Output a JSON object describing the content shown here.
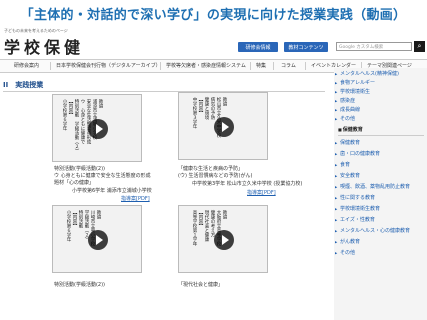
{
  "banner": {
    "title": "「主体的・対話的で深い学び」の実現に向けた授業実践（動画）"
  },
  "header": {
    "logo_sub": "子どもの未来を考えるためのページ",
    "logo": "学校保健",
    "btn1": "研修会情報",
    "btn2": "教材コンテンツ",
    "search_placeholder": "Google カスタム検索"
  },
  "nav": [
    "研修会案内",
    "日本学校保健会刊行物（デジタルアーカイブ）",
    "学校等欠席者・感染症情報システム",
    "特集",
    "コラム",
    "イベントカレンダー",
    "テーマ別関連ページ"
  ],
  "section": {
    "title": "II　実践授業"
  },
  "videos": [
    {
      "lines": [
        "小学校第６学年",
        "【内容】",
        "特別活動　学級活動（２）",
        "ウ　心身ともに健康で",
        "安全な生活態度の形成",
        "浦添市立浦城小学校",
        "教諭"
      ],
      "cap1": "特別活動(学級活動(2))",
      "cap2": "ウ 心身ともに健康で安全な生活態度の形成",
      "cap3": "題材「心の健康」",
      "cap4": "小学校第6学年 浦添市立浦城小学校",
      "pdf": "指導案[PDF]"
    },
    {
      "lines": [
        "中学校第３学年",
        "【内容】",
        "健康と環境",
        "病気の予防",
        "松山市立久米中学校",
        "教諭"
      ],
      "cap1": "「健康な生活と疾病の予防」",
      "cap2": "(ウ) 生活習慣病などの予防(がん)",
      "cap3": "",
      "cap4": "中学校第3学年 松山市立久米中学校 (授業協力校)",
      "pdf": "指導案[PDF]"
    },
    {
      "lines": [
        "小学校第６学年",
        "【内容】",
        "特別活動",
        "学級活動（２）",
        "川崎市立東小学校",
        "教諭"
      ],
      "cap1": "特別活動(学級活動(2))",
      "cap2": "",
      "cap3": "",
      "cap4": "",
      "pdf": ""
    },
    {
      "lines": [
        "高等学校第１学年",
        "【内容】",
        "現代社会と健康",
        "健康の考え方",
        "大阪府立高等学校",
        "教諭"
      ],
      "cap1": "「現代社会と健康」",
      "cap2": "",
      "cap3": "",
      "cap4": "",
      "pdf": ""
    }
  ],
  "sidebar": {
    "top_items": [
      "メンタルヘルス(精神保健)",
      "食物アレルギー",
      "学校環境衛生",
      "感染症",
      "成長曲線",
      "その他"
    ],
    "head": "保健教育",
    "items": [
      "保健教育",
      "歯・口の健康教育",
      "食育",
      "安全教育",
      "喫煙、飲酒、薬物乱用防止教育",
      "性に関する教育",
      "学校環境衛生教育",
      "エイズ・性教育",
      "メンタルヘルス・心の健康教育",
      "がん教育",
      "その他"
    ]
  }
}
